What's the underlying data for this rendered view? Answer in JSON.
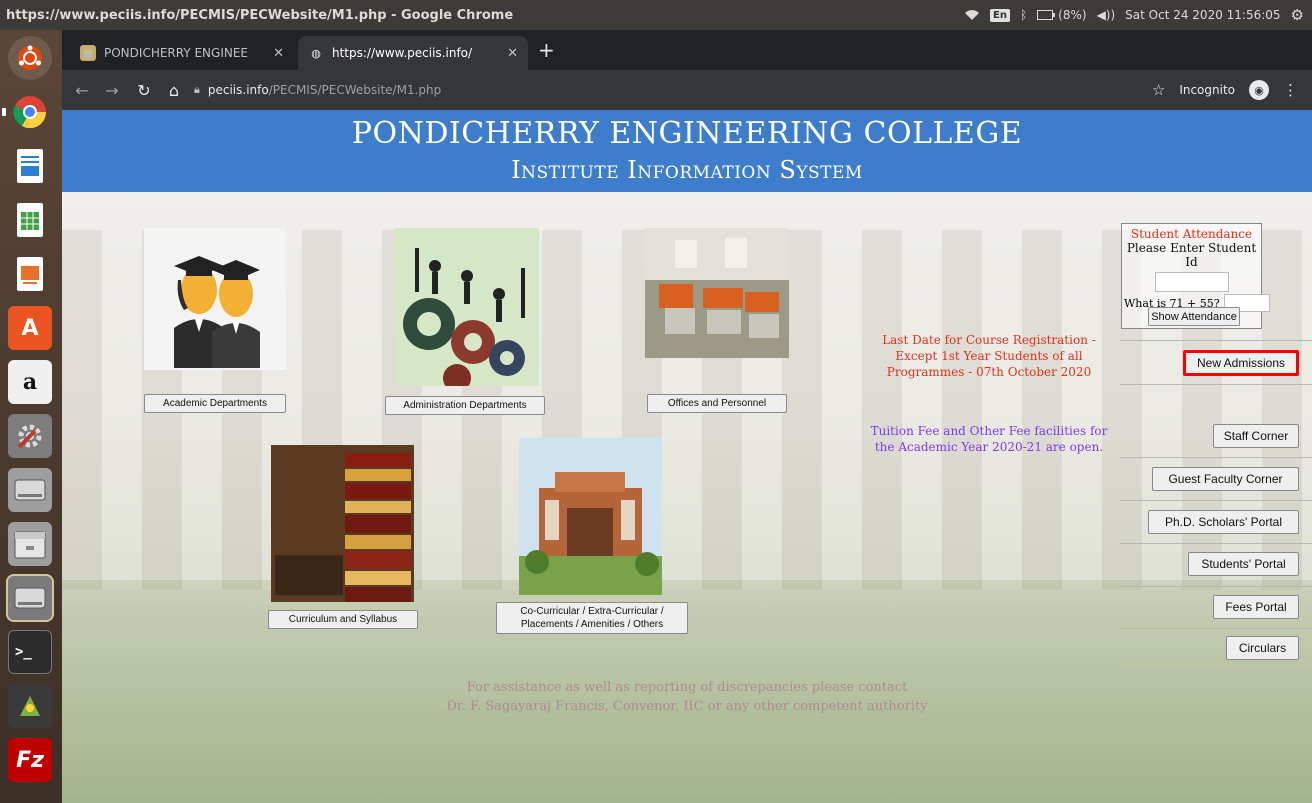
{
  "system_bar": {
    "window_title": "https://www.peciis.info/PECMIS/PECWebsite/M1.php - Google Chrome",
    "keyboard": "En",
    "battery": "(8%)",
    "datetime": "Sat Oct 24 2020 11:56:05"
  },
  "launcher": {
    "items": [
      "ubuntu-dash",
      "chrome",
      "libreoffice-writer",
      "libreoffice-calc",
      "libreoffice-impress",
      "ubuntu-software",
      "amazon",
      "system-settings",
      "drive",
      "file-manager",
      "drive-2",
      "terminal",
      "app",
      "filezilla"
    ]
  },
  "browser": {
    "tabs": [
      {
        "label": "PONDICHERRY ENGINEE",
        "active": false
      },
      {
        "label": "https://www.peciis.info/",
        "active": true
      }
    ],
    "new_tab": "+",
    "url_domain": "peciis.info",
    "url_path": "/PECMIS/PECWebsite/M1.php",
    "incognito_label": "Incognito"
  },
  "page": {
    "banner": {
      "title": "PONDICHERRY ENGINEERING COLLEGE",
      "subtitle": "Institute Information System"
    },
    "tiles": [
      {
        "label": "Academic Departments"
      },
      {
        "label": "Administration Departments"
      },
      {
        "label": "Offices and Personnel"
      },
      {
        "label": "Curriculum and Syllabus"
      },
      {
        "label_line1": "Co-Curricular / Extra-Curricular /",
        "label_line2": "Placements / Amenities / Others"
      }
    ],
    "attendance": {
      "heading": "Student Attendance",
      "prompt": "Please Enter Student Id",
      "captcha_question": "What is 71 + 55?",
      "button": "Show Attendance"
    },
    "notice_registration": {
      "line1": "Last Date for Course Registration -",
      "line2": "Except 1st Year Students of all",
      "line3": "Programmes - 07th October 2020"
    },
    "notice_fee": {
      "line1": "Tuition Fee and Other Fee facilities for",
      "line2": "the Academic Year 2020-21 are open."
    },
    "side_buttons": [
      "New Admissions",
      "Staff Corner",
      "Guest Faculty Corner",
      "Ph.D. Scholars' Portal",
      "Students' Portal",
      "Fees Portal",
      "Circulars"
    ],
    "contact": {
      "line1": "For assistance as well as reporting of discrepancies please contact",
      "line2": "Dr. F. Sagayaraj Francis, Convenor, IIC or any other competent authority"
    },
    "colors": {
      "banner": "#3d7dcb",
      "notice_red": "#e0301e",
      "notice_purple": "#7a3cf0",
      "highlight": "#ff0000"
    }
  }
}
